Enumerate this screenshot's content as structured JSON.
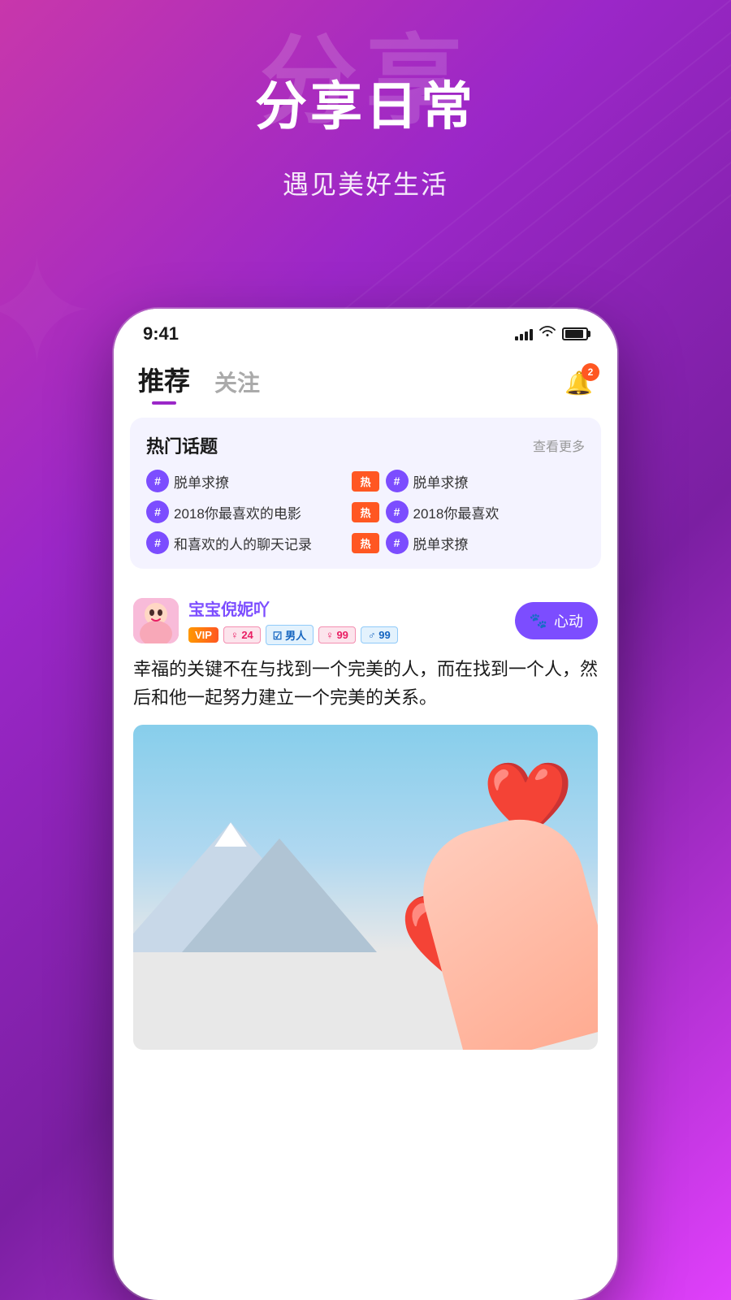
{
  "background": {
    "gradient_start": "#c837ab",
    "gradient_end": "#7b1fa2"
  },
  "hero": {
    "bg_text": "分享",
    "title": "分享日常",
    "subtitle": "遇见美好生活"
  },
  "phone": {
    "status_bar": {
      "time": "9:41",
      "badge_count": "2"
    },
    "nav_tabs": {
      "tab1": "推荐",
      "tab2": "关注",
      "bell_count": "2"
    },
    "hot_topics": {
      "title": "热门话题",
      "more_label": "查看更多",
      "items": [
        {
          "text": "脱单求撩",
          "hot": false
        },
        {
          "hot_badge": "热",
          "text2": "脱单求撩"
        },
        {
          "text": "2018你最喜欢的电影",
          "hot": false
        },
        {
          "hot_badge": "热",
          "text2": "2018你最喜欢"
        },
        {
          "text": "和喜欢的人的聊天记录",
          "hot": false
        },
        {
          "hot_badge": "热",
          "text2": "脱单求撩"
        }
      ]
    },
    "post": {
      "username": "宝宝倪妮吖",
      "tags": [
        "VIP",
        "♀ 24",
        "☑ 男人",
        "♀ 99",
        "♂ 99"
      ],
      "heart_button": "心动",
      "post_text": "幸福的关键不在与找到一个完美的人，而在找到一个人，然后和他一起努力建立一个完美的关系。"
    }
  }
}
